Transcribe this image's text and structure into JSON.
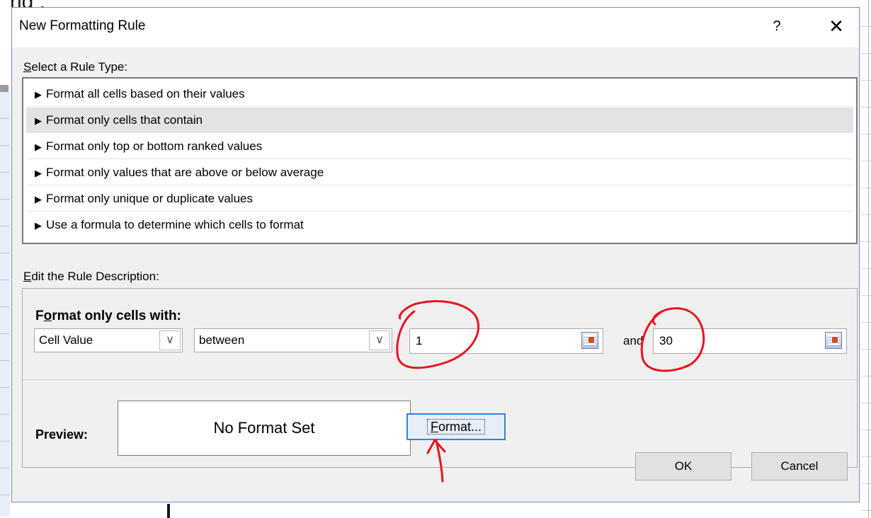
{
  "background": {
    "top_text": "ng              ,"
  },
  "dialog": {
    "title": "New Formatting Rule",
    "help_label": "?",
    "close_label": "✕"
  },
  "rule_type": {
    "label_prefix": "S",
    "label_rest": "elect a Rule Type:",
    "arrow": "▶",
    "items": [
      {
        "label": "Format all cells based on their values"
      },
      {
        "label": "Format only cells that contain",
        "selected": true
      },
      {
        "label": "Format only top or bottom ranked values"
      },
      {
        "label": "Format only values that are above or below average"
      },
      {
        "label": "Format only unique or duplicate values"
      },
      {
        "label": "Use a formula to determine which cells to format"
      }
    ]
  },
  "description": {
    "label_prefix": "E",
    "label_rest": "dit the Rule Description:",
    "format_with_prefix": "F",
    "format_with_underlined": "o",
    "format_with_rest": "rmat only cells with:",
    "condition_type": "Cell Value",
    "operator": "between",
    "value1": "1",
    "and_label": "and",
    "value2": "30",
    "dropdown_glyph": "∨"
  },
  "preview": {
    "label": "Preview:",
    "text": "No Format Set",
    "format_button_prefix": "F",
    "format_button_rest": "ormat..."
  },
  "buttons": {
    "ok": "OK",
    "cancel": "Cancel"
  },
  "colors": {
    "annotation": "#e8141e",
    "focus": "#3c7fd6",
    "selection": "#e3e3e3"
  }
}
